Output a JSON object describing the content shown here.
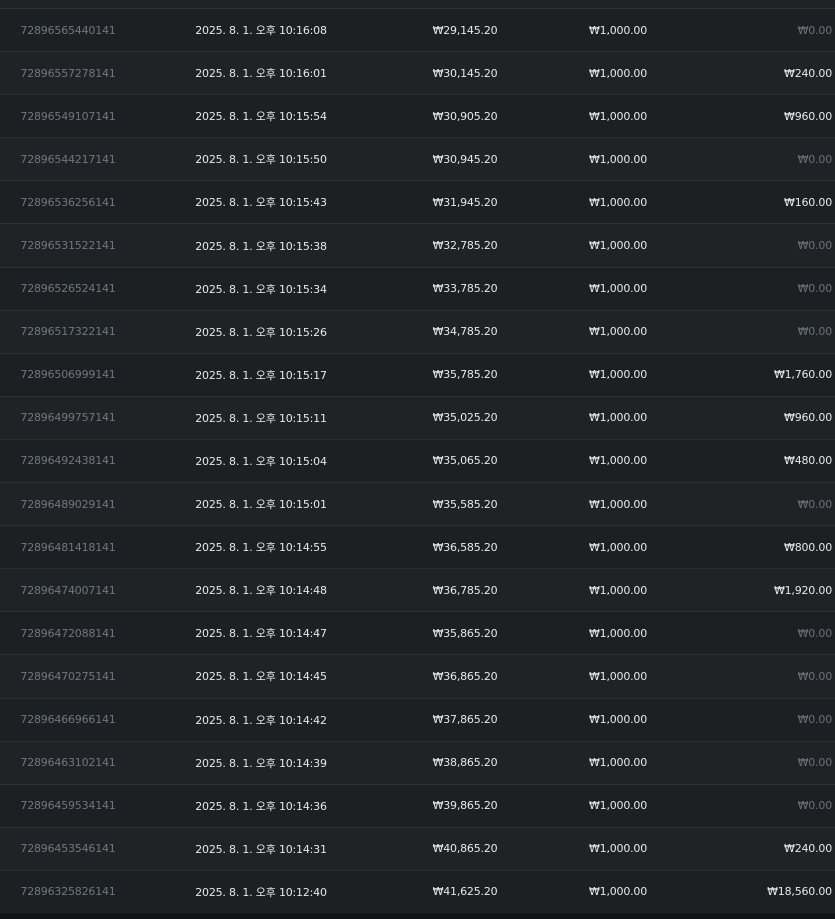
{
  "rows": [
    {
      "id": "72896565440141",
      "time": "2025. 8. 1. 오후 10:16:08",
      "balance": "₩29,145.20",
      "bet": "₩1,000.00",
      "win": "₩0.00"
    },
    {
      "id": "72896557278141",
      "time": "2025. 8. 1. 오후 10:16:01",
      "balance": "₩30,145.20",
      "bet": "₩1,000.00",
      "win": "₩240.00"
    },
    {
      "id": "72896549107141",
      "time": "2025. 8. 1. 오후 10:15:54",
      "balance": "₩30,905.20",
      "bet": "₩1,000.00",
      "win": "₩960.00"
    },
    {
      "id": "72896544217141",
      "time": "2025. 8. 1. 오후 10:15:50",
      "balance": "₩30,945.20",
      "bet": "₩1,000.00",
      "win": "₩0.00"
    },
    {
      "id": "72896536256141",
      "time": "2025. 8. 1. 오후 10:15:43",
      "balance": "₩31,945.20",
      "bet": "₩1,000.00",
      "win": "₩160.00"
    },
    {
      "id": "72896531522141",
      "time": "2025. 8. 1. 오후 10:15:38",
      "balance": "₩32,785.20",
      "bet": "₩1,000.00",
      "win": "₩0.00"
    },
    {
      "id": "72896526524141",
      "time": "2025. 8. 1. 오후 10:15:34",
      "balance": "₩33,785.20",
      "bet": "₩1,000.00",
      "win": "₩0.00"
    },
    {
      "id": "72896517322141",
      "time": "2025. 8. 1. 오후 10:15:26",
      "balance": "₩34,785.20",
      "bet": "₩1,000.00",
      "win": "₩0.00"
    },
    {
      "id": "72896506999141",
      "time": "2025. 8. 1. 오후 10:15:17",
      "balance": "₩35,785.20",
      "bet": "₩1,000.00",
      "win": "₩1,760.00"
    },
    {
      "id": "72896499757141",
      "time": "2025. 8. 1. 오후 10:15:11",
      "balance": "₩35,025.20",
      "bet": "₩1,000.00",
      "win": "₩960.00"
    },
    {
      "id": "72896492438141",
      "time": "2025. 8. 1. 오후 10:15:04",
      "balance": "₩35,065.20",
      "bet": "₩1,000.00",
      "win": "₩480.00"
    },
    {
      "id": "72896489029141",
      "time": "2025. 8. 1. 오후 10:15:01",
      "balance": "₩35,585.20",
      "bet": "₩1,000.00",
      "win": "₩0.00"
    },
    {
      "id": "72896481418141",
      "time": "2025. 8. 1. 오후 10:14:55",
      "balance": "₩36,585.20",
      "bet": "₩1,000.00",
      "win": "₩800.00"
    },
    {
      "id": "72896474007141",
      "time": "2025. 8. 1. 오후 10:14:48",
      "balance": "₩36,785.20",
      "bet": "₩1,000.00",
      "win": "₩1,920.00"
    },
    {
      "id": "72896472088141",
      "time": "2025. 8. 1. 오후 10:14:47",
      "balance": "₩35,865.20",
      "bet": "₩1,000.00",
      "win": "₩0.00"
    },
    {
      "id": "72896470275141",
      "time": "2025. 8. 1. 오후 10:14:45",
      "balance": "₩36,865.20",
      "bet": "₩1,000.00",
      "win": "₩0.00"
    },
    {
      "id": "72896466966141",
      "time": "2025. 8. 1. 오후 10:14:42",
      "balance": "₩37,865.20",
      "bet": "₩1,000.00",
      "win": "₩0.00"
    },
    {
      "id": "72896463102141",
      "time": "2025. 8. 1. 오후 10:14:39",
      "balance": "₩38,865.20",
      "bet": "₩1,000.00",
      "win": "₩0.00"
    },
    {
      "id": "72896459534141",
      "time": "2025. 8. 1. 오후 10:14:36",
      "balance": "₩39,865.20",
      "bet": "₩1,000.00",
      "win": "₩0.00"
    },
    {
      "id": "72896453546141",
      "time": "2025. 8. 1. 오후 10:14:31",
      "balance": "₩40,865.20",
      "bet": "₩1,000.00",
      "win": "₩240.00"
    },
    {
      "id": "72896325826141",
      "time": "2025. 8. 1. 오후 10:12:40",
      "balance": "₩41,625.20",
      "bet": "₩1,000.00",
      "win": "₩18,560.00"
    }
  ],
  "colors": {
    "background": "#1a1d20",
    "text_primary": "#e6e8ea",
    "text_muted": "#6f777f",
    "zero_win": "#6a7178"
  }
}
